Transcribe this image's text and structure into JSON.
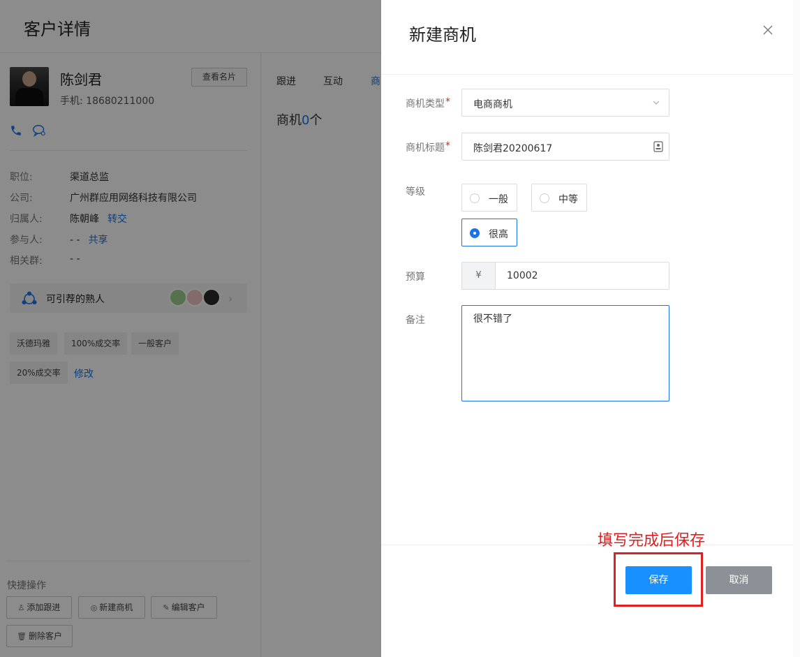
{
  "page": {
    "title": "客户详情"
  },
  "customer": {
    "name": "陈剑君",
    "phone": "手机: 18680211000",
    "view_card_label": "查看名片",
    "info": [
      {
        "key": "职位:",
        "value": "渠道总监",
        "link": ""
      },
      {
        "key": "公司:",
        "value": "广州群应用网络科技有限公司",
        "link": ""
      },
      {
        "key": "归属人:",
        "value": "陈朝峰",
        "link": "转交"
      },
      {
        "key": "参与人:",
        "value": "- -",
        "link": "共享"
      },
      {
        "key": "相关群:",
        "value": "- -",
        "link": ""
      }
    ],
    "referral_label": "可引荐的熟人",
    "tags": [
      "沃德玛雅",
      "100%成交率",
      "一般客户",
      "20%成交率"
    ],
    "tags_edit_label": "修改"
  },
  "quick_actions": {
    "title": "快捷操作",
    "buttons": [
      "添加跟进",
      "新建商机",
      "编辑客户",
      "删除客户"
    ]
  },
  "tabs": [
    "跟进",
    "互动",
    "商"
  ],
  "opportunity_count": {
    "prefix": "商机",
    "count": "0",
    "suffix": "个"
  },
  "drawer": {
    "title": "新建商机",
    "fields": {
      "type": {
        "label": "商机类型",
        "value": "电商商机"
      },
      "title": {
        "label": "商机标题",
        "value": "陈剑君20200617"
      },
      "level": {
        "label": "等级",
        "options": [
          "一般",
          "中等",
          "很高"
        ],
        "selected": "很高"
      },
      "budget": {
        "label": "预算",
        "prefix": "¥",
        "value": "10002"
      },
      "remark": {
        "label": "备注",
        "value": "很不错了"
      }
    },
    "save_label": "保存",
    "cancel_label": "取消"
  },
  "annotation": {
    "text": "填写完成后保存",
    "color": "#e02020"
  },
  "colors": {
    "accent": "#1a73e8",
    "primary_button": "#1890ff",
    "cancel_button": "#8c9197"
  }
}
